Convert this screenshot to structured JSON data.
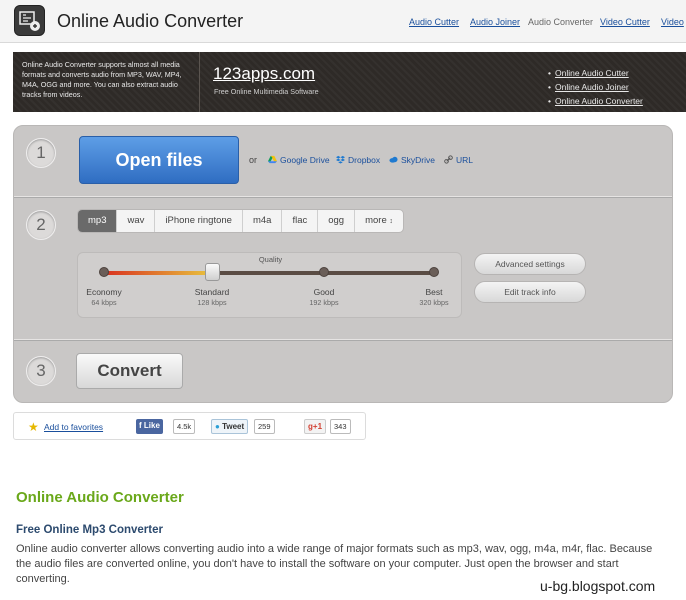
{
  "header": {
    "title": "Online Audio Converter",
    "nav": [
      "Audio Cutter",
      "Audio Joiner",
      "Audio Converter",
      "Video Cutter",
      "Video"
    ]
  },
  "banner": {
    "description": "Online Audio Converter supports almost all media formats and converts audio from MP3, WAV, MP4, M4A, OGG and more. You can also extract audio tracks from videos.",
    "brand": "123apps.com",
    "brand_sub": "Free Online Multimedia Software",
    "links": [
      "Online Audio Cutter",
      "Online Audio Joiner",
      "Online Audio Converter"
    ]
  },
  "step1": {
    "number": "1",
    "open_label": "Open files",
    "or_text": "or",
    "sources": [
      "Google Drive",
      "Dropbox",
      "SkyDrive",
      "URL"
    ]
  },
  "step2": {
    "number": "2",
    "formats": [
      "mp3",
      "wav",
      "iPhone ringtone",
      "m4a",
      "flac",
      "ogg",
      "more"
    ],
    "active_format": "mp3",
    "quality_label": "Quality",
    "levels": [
      {
        "name": "Economy",
        "rate": "64 kbps"
      },
      {
        "name": "Standard",
        "rate": "128 kbps"
      },
      {
        "name": "Good",
        "rate": "192 kbps"
      },
      {
        "name": "Best",
        "rate": "320 kbps"
      }
    ],
    "selected_level": "Standard",
    "advanced_label": "Advanced settings",
    "track_info_label": "Edit track info"
  },
  "step3": {
    "number": "3",
    "convert_label": "Convert"
  },
  "social": {
    "favorites": "Add to favorites",
    "like": "Like",
    "like_count": "4.5k",
    "tweet": "Tweet",
    "tweet_count": "259",
    "gplus": "+1",
    "gplus_count": "343"
  },
  "content": {
    "heading": "Online Audio Converter",
    "subheading": "Free Online Mp3 Converter",
    "paragraph": "Online audio converter allows converting audio into a wide range of major formats such as mp3, wav, ogg, m4a, m4r, flac. Because the audio files are converted online, you don't have to install the software on your computer. Just open the browser and start converting."
  },
  "watermark": "u-bg.blogspot.com",
  "colors": {
    "accent_blue": "#2f6dc2",
    "link": "#1a4f9c",
    "heading_green": "#6aa81a",
    "subheading": "#2c4a6e"
  }
}
